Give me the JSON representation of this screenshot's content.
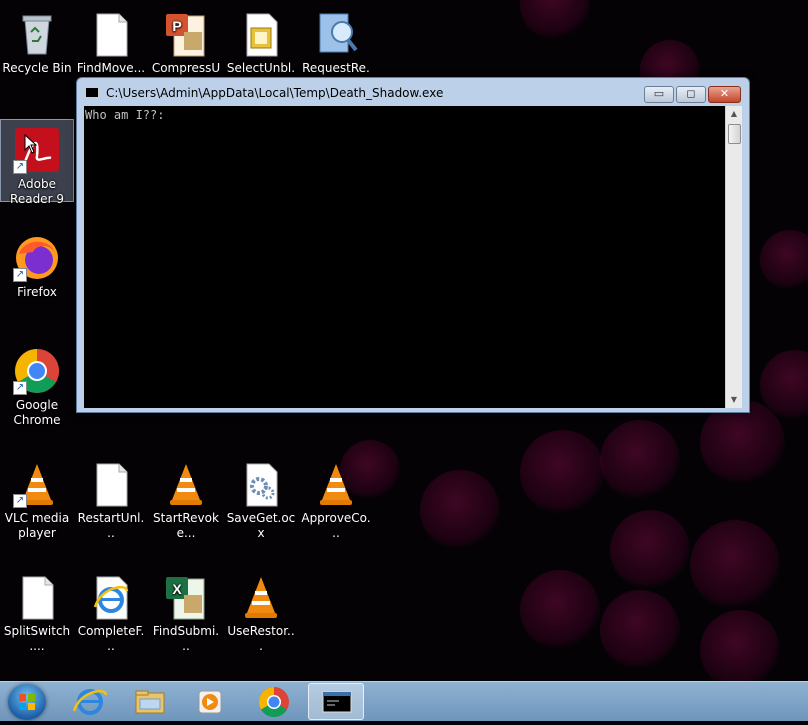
{
  "desktop": {
    "icons": [
      {
        "label": "Recycle Bin",
        "icon": "recycle-bin-icon"
      },
      {
        "label": "FindMove....",
        "icon": "blank-file-icon"
      },
      {
        "label": "CompressU...",
        "icon": "powerpoint-file-icon"
      },
      {
        "label": "SelectUnbl...",
        "icon": "image-file-icon"
      },
      {
        "label": "RequestRe...",
        "icon": "search-file-icon"
      },
      {
        "label": "Adobe Reader 9",
        "icon": "adobe-reader-icon"
      },
      {
        "label": "Firefox",
        "icon": "firefox-icon"
      },
      {
        "label": "Google Chrome",
        "icon": "chrome-icon"
      },
      {
        "label": "VLC media player",
        "icon": "vlc-icon"
      },
      {
        "label": "RestartUnl...",
        "icon": "blank-file-icon"
      },
      {
        "label": "StartRevoke...",
        "icon": "vlc-icon"
      },
      {
        "label": "SaveGet.ocx",
        "icon": "gear-file-icon"
      },
      {
        "label": "ApproveCo...",
        "icon": "vlc-icon"
      },
      {
        "label": "SplitSwitch....",
        "icon": "blank-file-icon"
      },
      {
        "label": "CompleteF...",
        "icon": "internet-explorer-icon"
      },
      {
        "label": "FindSubmi...",
        "icon": "excel-file-icon"
      },
      {
        "label": "UseRestor...",
        "icon": "vlc-icon"
      }
    ]
  },
  "window": {
    "title": "C:\\Users\\Admin\\AppData\\Local\\Temp\\Death_Shadow.exe",
    "console_output": "Who am I??:",
    "minimize_glyph": "▭",
    "maximize_glyph": "◻",
    "close_glyph": "✕"
  },
  "taskbar": {
    "items": [
      "start-orb",
      "internet-explorer",
      "file-explorer",
      "media-player",
      "chrome",
      "console-window"
    ]
  },
  "colors": {
    "desktop_bg": "#050205",
    "bokeh": "#6e0a3c",
    "window_frame": "#bcd1e9",
    "console_bg": "#000000",
    "console_text": "#c0c0c0",
    "taskbar": "#7fa4c8"
  }
}
